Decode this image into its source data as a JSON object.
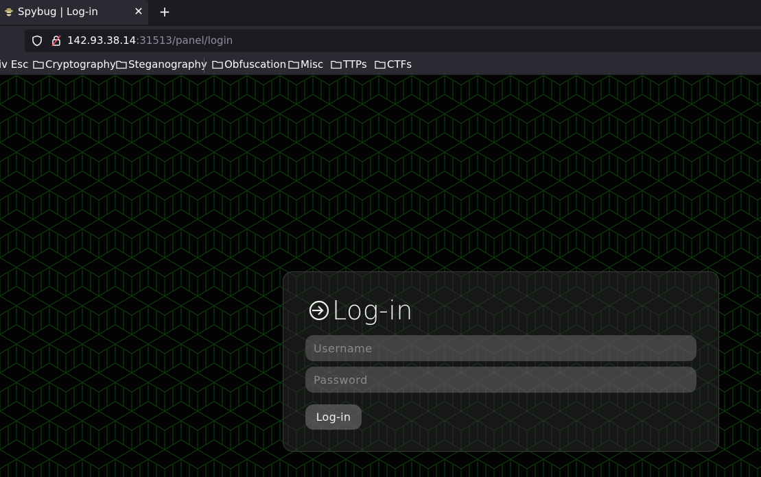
{
  "browser": {
    "tab": {
      "title": "Spybug | Log-in"
    },
    "url": {
      "host": "142.93.38.14",
      "rest": ":31513/panel/login"
    },
    "bookmarks": [
      {
        "label": "iv Esc",
        "folder": false
      },
      {
        "label": "Cryptography",
        "folder": true
      },
      {
        "label": "Steganography",
        "folder": true
      },
      {
        "label": "Obfuscation",
        "folder": true
      },
      {
        "label": "Misc",
        "folder": true
      },
      {
        "label": "TTPs",
        "folder": true
      },
      {
        "label": "CTFs",
        "folder": true
      }
    ]
  },
  "login": {
    "title": "Log-in",
    "username_placeholder": "Username",
    "password_placeholder": "Password",
    "submit_label": "Log-in"
  },
  "colors": {
    "pattern": "#0f3d0f",
    "background": "#030303"
  }
}
